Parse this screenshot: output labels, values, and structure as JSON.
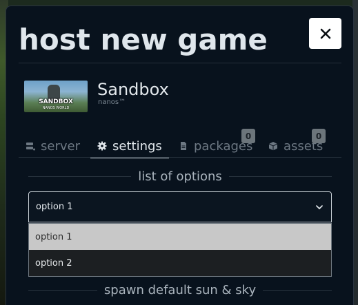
{
  "dialog": {
    "title": "host new game",
    "close_icon": "close-icon"
  },
  "game": {
    "name": "Sandbox",
    "vendor": "nanos™",
    "thumbnail_text": "SANDBOX",
    "thumbnail_subtext": "NANOS WORLD"
  },
  "tabs": [
    {
      "label": "server",
      "icon": "server-icon",
      "active": false
    },
    {
      "label": "settings",
      "icon": "gear-icon",
      "active": true
    },
    {
      "label": "packages",
      "icon": "file-icon",
      "active": false,
      "badge": "0"
    },
    {
      "label": "assets",
      "icon": "cube-icon",
      "active": false,
      "badge": "0"
    }
  ],
  "settings": {
    "list_heading": "list of options",
    "select_value": "option 1",
    "options": [
      "option 1",
      "option 2"
    ],
    "hovered_option": "option 1",
    "spawn_heading": "spawn default sun & sky"
  },
  "colors": {
    "dialog_bg": "#08121d",
    "accent_text": "#e2e8ed",
    "muted_text": "#6d7883",
    "badge_bg": "#6c757b",
    "hover_option_bg": "#c8c8c8"
  }
}
